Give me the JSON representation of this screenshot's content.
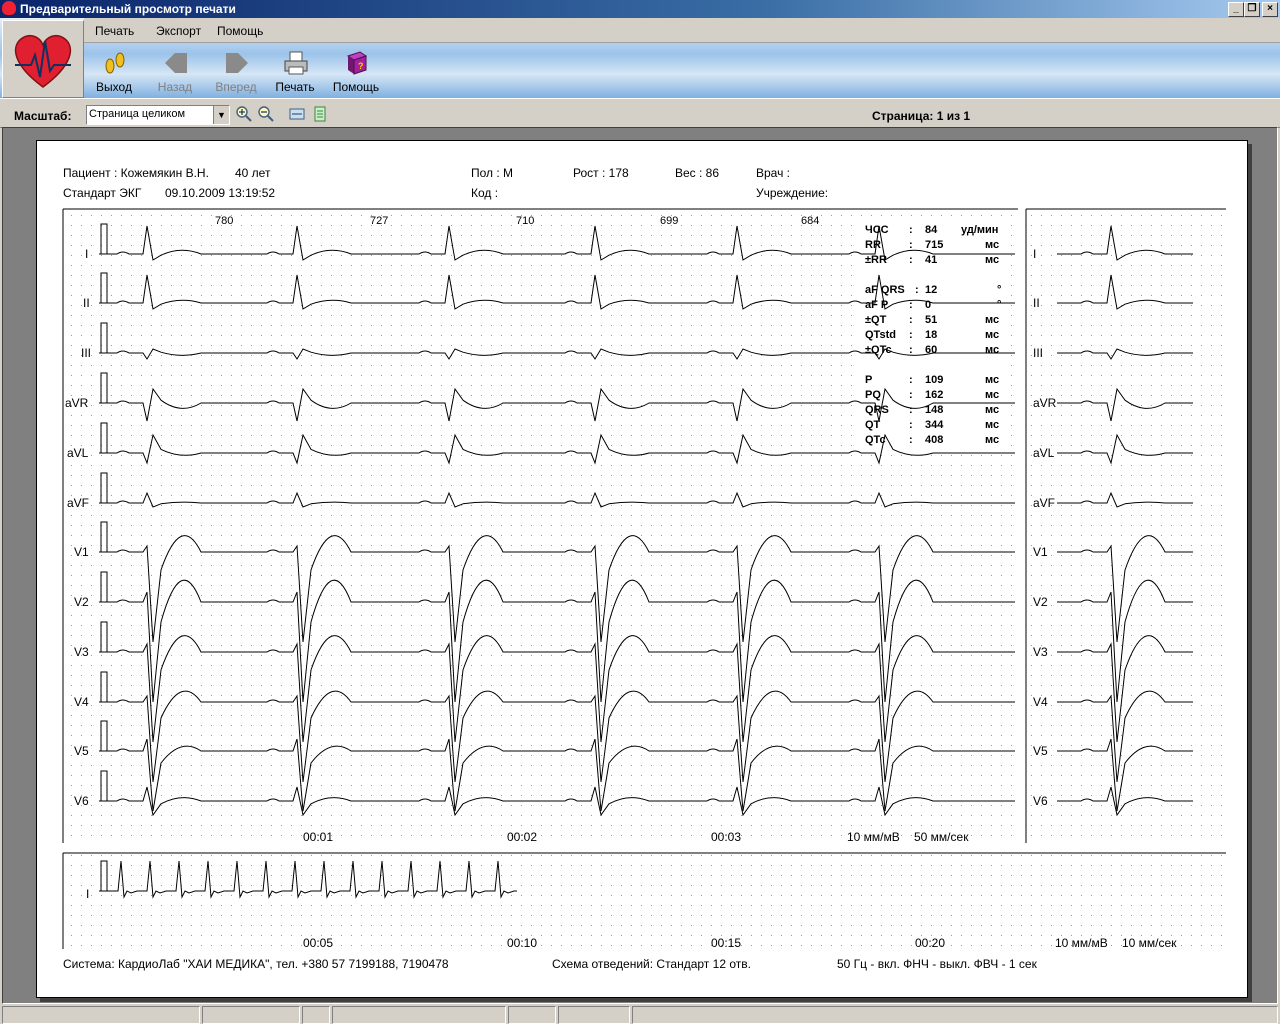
{
  "window": {
    "title": "Предварительный просмотр печати"
  },
  "menu": [
    "Печать",
    "Экспорт",
    "Помощь"
  ],
  "toolbar": {
    "exit": "Выход",
    "back": "Назад",
    "forward": "Вперед",
    "print": "Печать",
    "help": "Помощь"
  },
  "zoom": {
    "label": "Масштаб:",
    "value": "Страница целиком"
  },
  "page_info": "Страница: 1 из 1",
  "header": {
    "patient": "Пациент : Кожемякин В.Н.",
    "age": "40 лет",
    "standard": "Стандарт ЭКГ",
    "datetime": "09.10.2009 13:19:52",
    "sex": "Пол : М",
    "height": "Рост : 178",
    "weight": "Вес : 86",
    "doctor": "Врач :",
    "code": "Код :",
    "institution": "Учреждение:"
  },
  "leads": [
    "I",
    "II",
    "III",
    "aVR",
    "aVL",
    "aVF",
    "V1",
    "V2",
    "V3",
    "V4",
    "V5",
    "V6"
  ],
  "rr_intervals": [
    "780",
    "727",
    "710",
    "699",
    "684"
  ],
  "measurements": [
    {
      "name": "ЧСС",
      "value": "84",
      "unit": "уд/мин"
    },
    {
      "name": "RR",
      "value": "715",
      "unit": "мс"
    },
    {
      "name": "±RR",
      "value": "41",
      "unit": "мс"
    },
    {
      "name": "aF QRS",
      "value": "12",
      "unit": "°"
    },
    {
      "name": "aF P",
      "value": "0",
      "unit": "°"
    },
    {
      "name": "±QT",
      "value": "51",
      "unit": "мс"
    },
    {
      "name": "QTstd",
      "value": "18",
      "unit": "мс"
    },
    {
      "name": "±QTc",
      "value": "60",
      "unit": "мс"
    },
    {
      "name": "P",
      "value": "109",
      "unit": "мс"
    },
    {
      "name": "PQ",
      "value": "162",
      "unit": "мс"
    },
    {
      "name": "QRS",
      "value": "148",
      "unit": "мс"
    },
    {
      "name": "QT",
      "value": "344",
      "unit": "мс"
    },
    {
      "name": "QTc",
      "value": "408",
      "unit": "мс"
    }
  ],
  "time_marks_main": [
    "00:01",
    "00:02",
    "00:03"
  ],
  "scale_main": {
    "amplitude": "10 мм/мВ",
    "speed": "50 мм/сек"
  },
  "rhythm": {
    "lead": "I",
    "time_marks": [
      "00:05",
      "00:10",
      "00:15",
      "00:20"
    ],
    "amplitude": "10 мм/мВ",
    "speed": "10 мм/сек"
  },
  "footer": {
    "system": "Система: КардиоЛаб  \"ХАИ МЕДИКА\",   тел. +380 57 7199188, 7190478",
    "scheme": "Схема отведений: Стандарт 12 отв.",
    "filters": "50 Гц - вкл.   ФНЧ - выкл.   ФВЧ - 1 сек"
  },
  "colors": {
    "title_bar": "#0a246a",
    "sky": "#9cc3ea",
    "heart": "#e02030",
    "help_book": "#8b1a8b"
  },
  "icons": {
    "exit": "footprints-icon",
    "back": "arrow-left-icon",
    "forward": "arrow-right-icon",
    "print": "printer-icon",
    "help": "help-book-icon",
    "zoom_in": "zoom-in-icon",
    "zoom_out": "zoom-out-icon"
  }
}
